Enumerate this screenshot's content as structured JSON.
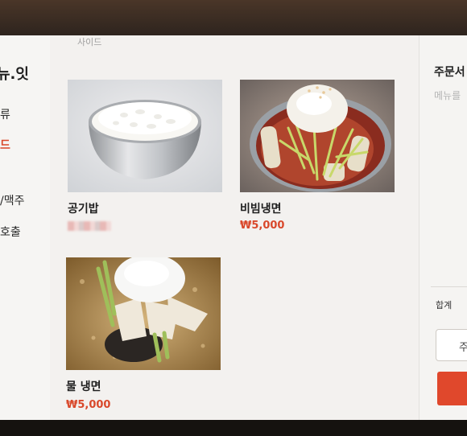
{
  "sidebar": {
    "brand": "뉴.잇",
    "items": [
      {
        "label": "류"
      },
      {
        "label": "드"
      },
      {
        "label": "/맥주"
      },
      {
        "label": "호출"
      }
    ]
  },
  "section_label": "사이드",
  "menu": [
    {
      "name": "공기밥",
      "price": "",
      "image": "rice-bowl"
    },
    {
      "name": "비빔냉면",
      "price": "₩5,000",
      "image": "bibim-naengmyeon"
    },
    {
      "name": "물 냉면",
      "price": "₩5,000",
      "image": "mul-naengmyeon"
    }
  ],
  "order": {
    "title": "주문서",
    "hint": "메뉴를",
    "total_label": "합계",
    "secondary_button": "주"
  },
  "colors": {
    "accent": "#d9482b",
    "screen_bg": "#f3f1ef"
  }
}
